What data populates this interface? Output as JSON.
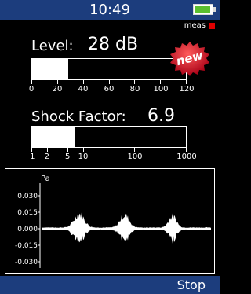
{
  "status": {
    "time": "10:49",
    "indicator": "meas",
    "indicator_color": "#e00000",
    "battery_color": "#5bbf2f"
  },
  "level": {
    "label": "Level:",
    "value": "28 dB",
    "scale_min": 0,
    "scale_max": 120,
    "current": 28,
    "ticks": [
      "0",
      "20",
      "40",
      "60",
      "80",
      "100",
      "120"
    ]
  },
  "badge": {
    "text": "new",
    "color": "#c8001e"
  },
  "shock": {
    "label": "Shock Factor:",
    "value": "6.9",
    "scale": "log",
    "scale_min": 1,
    "scale_max": 1000,
    "current": 6.9,
    "ticks": [
      "1",
      "2",
      "5",
      "10",
      "100",
      "1000"
    ]
  },
  "waveform": {
    "unit": "Pa",
    "yticks": [
      "0.030",
      "0.015",
      "0.000",
      "-0.015",
      "-0.030"
    ]
  },
  "bottom": {
    "stop_label": "Stop"
  },
  "colors": {
    "bar_background": "#1c3d7d",
    "foreground": "#ffffff",
    "background": "#000000"
  }
}
